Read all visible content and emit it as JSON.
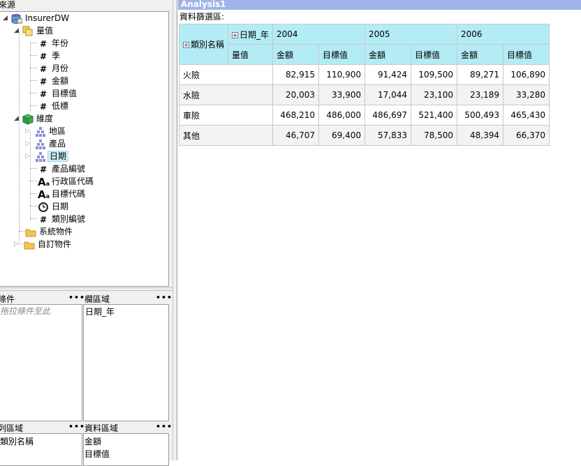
{
  "left_panel": {
    "title": "來源",
    "tree": [
      {
        "label": "InsurerDW",
        "icon": "database-icon"
      },
      {
        "label": "量值",
        "icon": "measures-folder-icon"
      },
      {
        "label": "年份",
        "icon": "hash-icon"
      },
      {
        "label": "季",
        "icon": "hash-icon"
      },
      {
        "label": "月份",
        "icon": "hash-icon"
      },
      {
        "label": "金額",
        "icon": "hash-icon"
      },
      {
        "label": "目標值",
        "icon": "hash-icon"
      },
      {
        "label": "低標",
        "icon": "hash-icon"
      },
      {
        "label": "維度",
        "icon": "dimension-cube-icon"
      },
      {
        "label": "地區",
        "icon": "hierarchy-icon"
      },
      {
        "label": "產品",
        "icon": "hierarchy-icon"
      },
      {
        "label": "日期",
        "icon": "hierarchy-icon"
      },
      {
        "label": "產品編號",
        "icon": "hash-icon"
      },
      {
        "label": "行政區代碼",
        "icon": "text-attribute-icon"
      },
      {
        "label": "目標代碼",
        "icon": "text-attribute-icon"
      },
      {
        "label": "日期",
        "icon": "clock-icon"
      },
      {
        "label": "類別編號",
        "icon": "hash-icon"
      },
      {
        "label": "系統物件",
        "icon": "folder-icon"
      },
      {
        "label": "自訂物件",
        "icon": "folder-icon"
      }
    ],
    "panes": {
      "conditions": {
        "title": "條件",
        "placeholder": "拖拉條件至此"
      },
      "columns": {
        "title": "欄區域",
        "items": [
          "日期_年"
        ]
      },
      "rows": {
        "title": "列區域",
        "items": [
          "類別名稱"
        ]
      },
      "data": {
        "title": "資料區域",
        "items": [
          "金額",
          "目標值"
        ]
      },
      "menu_dots": "•••"
    }
  },
  "analysis": {
    "tab_title": "Analysis1",
    "filter_label": "資料篩選區:",
    "pivot": {
      "row_header": "類別名稱",
      "column_header": "日期_年",
      "measure_header": "量值",
      "years": [
        "2004",
        "2005",
        "2006"
      ],
      "measures": [
        "金額",
        "目標值"
      ],
      "rows": [
        {
          "label": "火險",
          "values": [
            "82,915",
            "110,900",
            "91,424",
            "109,500",
            "89,271",
            "106,890"
          ]
        },
        {
          "label": "水險",
          "values": [
            "20,003",
            "33,900",
            "17,044",
            "23,100",
            "23,189",
            "33,280"
          ]
        },
        {
          "label": "車險",
          "values": [
            "468,210",
            "486,000",
            "486,697",
            "521,400",
            "500,493",
            "465,430"
          ]
        },
        {
          "label": "其他",
          "values": [
            "46,707",
            "69,400",
            "57,833",
            "78,500",
            "48,394",
            "66,370"
          ]
        }
      ]
    }
  },
  "colors": {
    "tab_bar": "#9fb3e8",
    "header_cell": "#b4ecf6",
    "selection": "#cdeffa"
  }
}
